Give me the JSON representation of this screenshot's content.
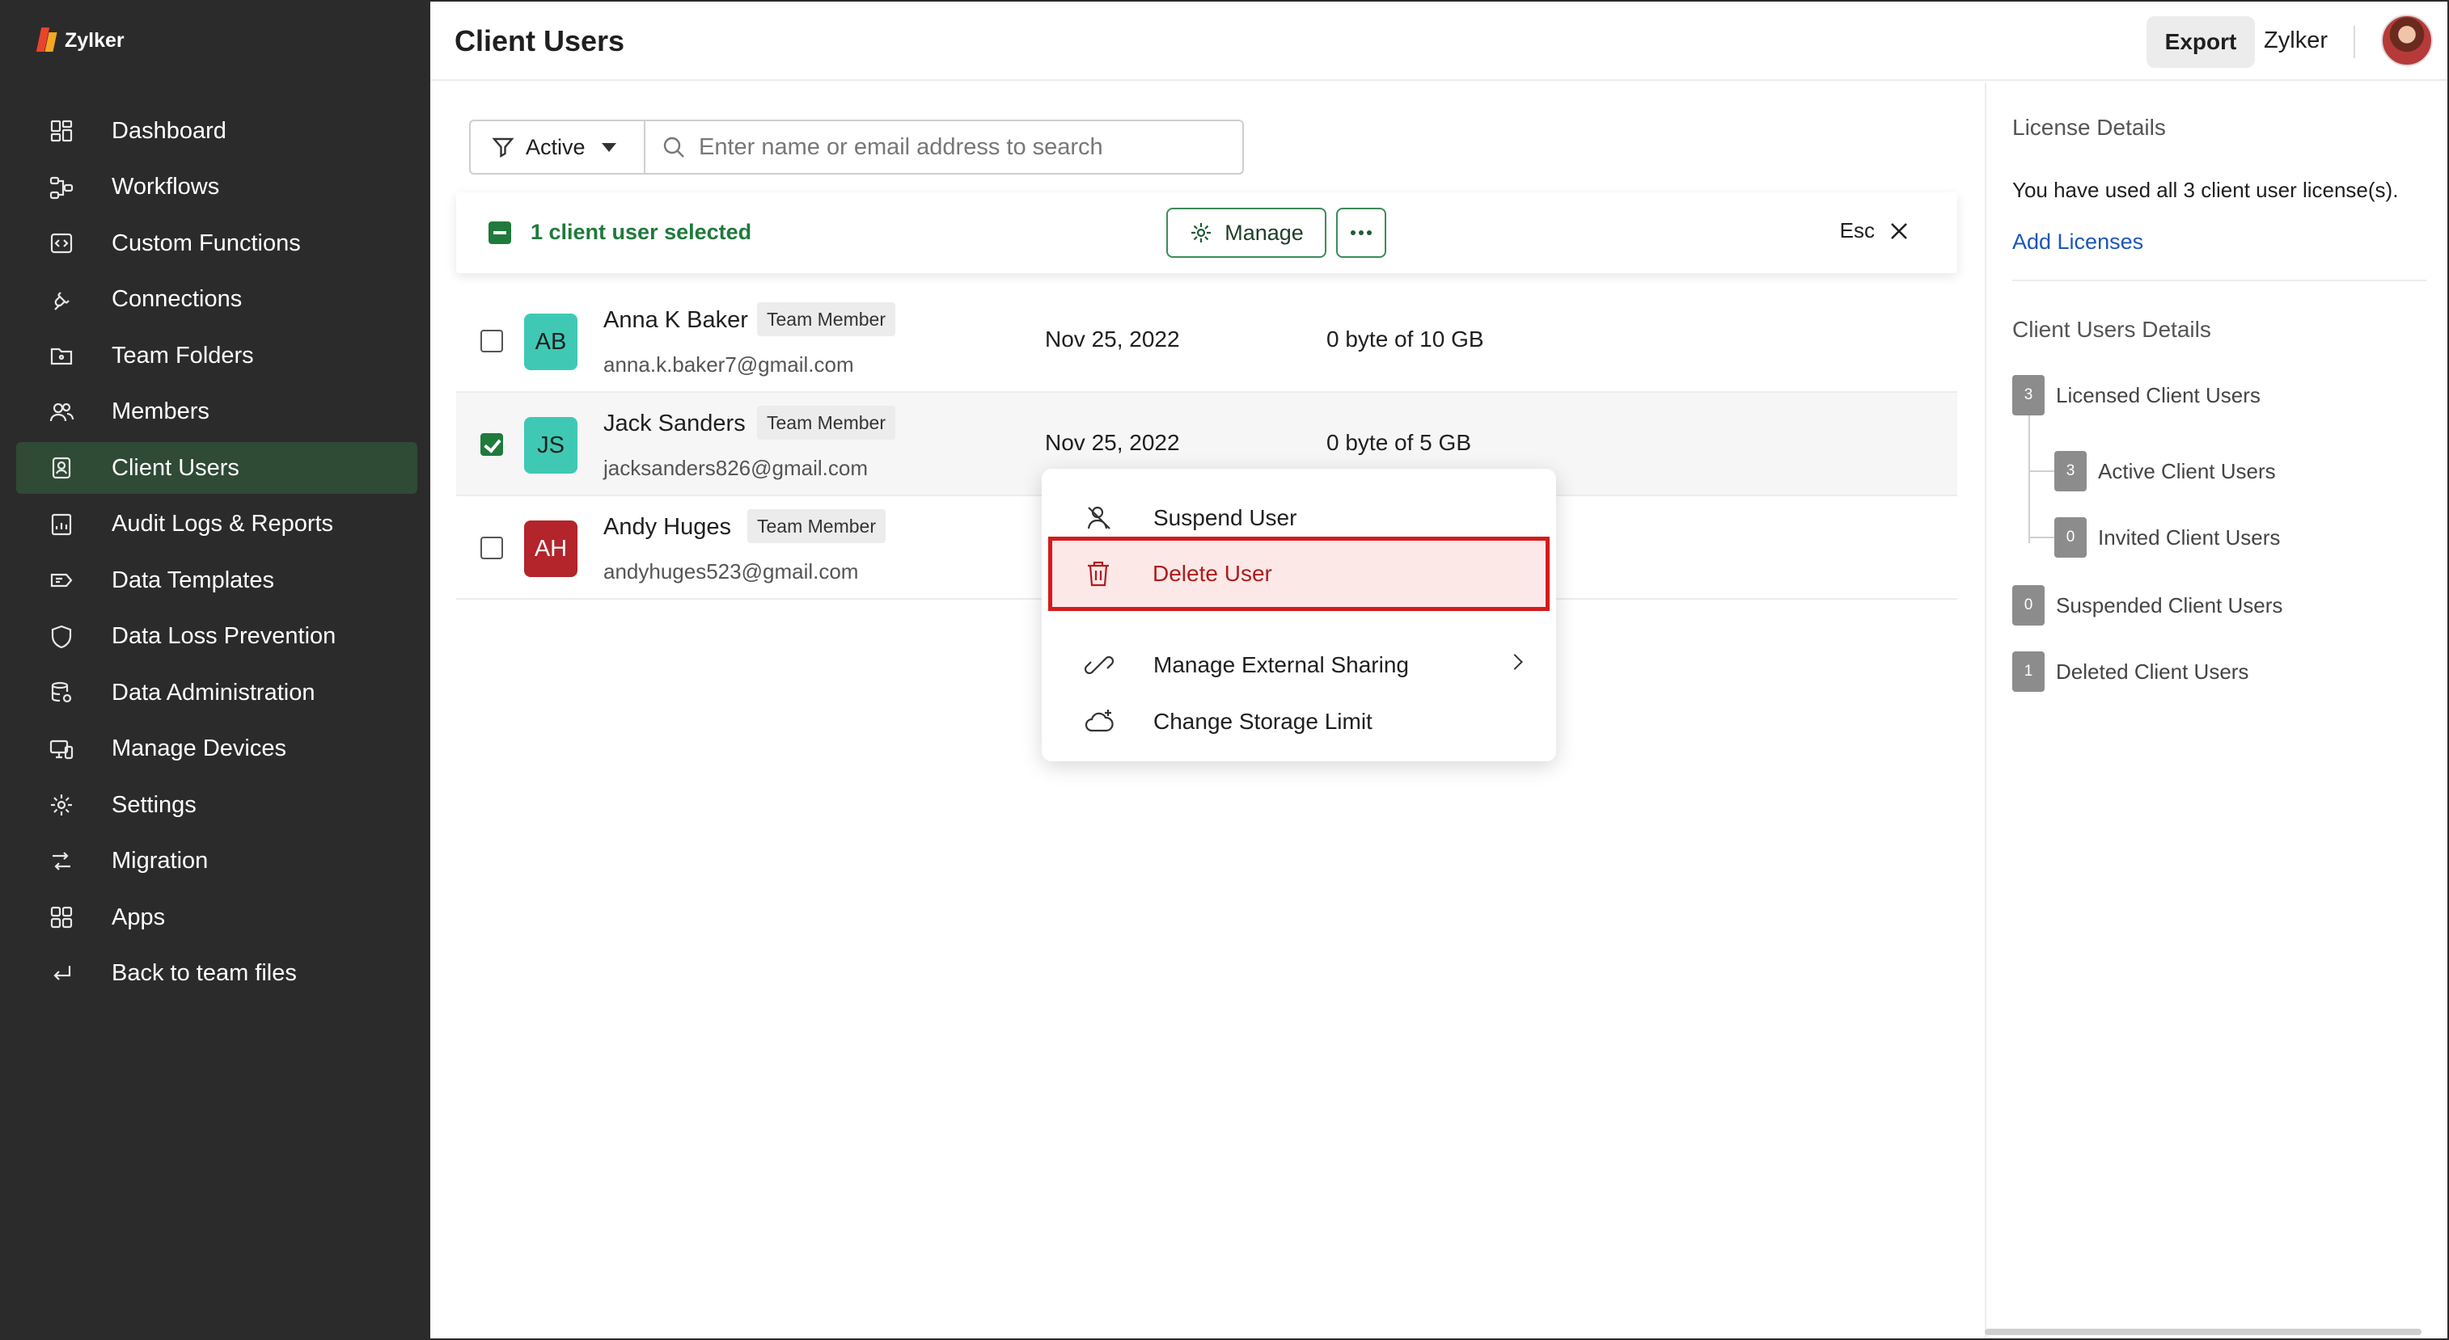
{
  "app": {
    "brand": "Zylker"
  },
  "sidebar": {
    "items": [
      {
        "label": "Dashboard",
        "icon": "dashboard-icon"
      },
      {
        "label": "Workflows",
        "icon": "workflow-icon"
      },
      {
        "label": "Custom Functions",
        "icon": "code-icon"
      },
      {
        "label": "Connections",
        "icon": "plug-icon"
      },
      {
        "label": "Team Folders",
        "icon": "folder-icon"
      },
      {
        "label": "Members",
        "icon": "users-icon"
      },
      {
        "label": "Client Users",
        "icon": "id-badge-icon",
        "active": true
      },
      {
        "label": "Audit Logs & Reports",
        "icon": "report-icon"
      },
      {
        "label": "Data Templates",
        "icon": "tag-icon"
      },
      {
        "label": "Data Loss Prevention",
        "icon": "shield-icon"
      },
      {
        "label": "Data Administration",
        "icon": "database-icon"
      },
      {
        "label": "Manage Devices",
        "icon": "devices-icon"
      },
      {
        "label": "Settings",
        "icon": "gear-icon"
      },
      {
        "label": "Migration",
        "icon": "migration-icon"
      },
      {
        "label": "Apps",
        "icon": "apps-icon"
      },
      {
        "label": "Back to team files",
        "icon": "back-arrow-icon"
      }
    ]
  },
  "header": {
    "title": "Client Users",
    "export_label": "Export",
    "org_name": "Zylker"
  },
  "filter": {
    "status": "Active",
    "search_placeholder": "Enter name or email address to search"
  },
  "selection": {
    "text": "1 client user selected",
    "manage_label": "Manage",
    "esc_label": "Esc"
  },
  "users": [
    {
      "initials": "AB",
      "avatar_color": "#3fc9b4",
      "name": "Anna K Baker",
      "role": "Team Member",
      "email": "anna.k.baker7@gmail.com",
      "date": "Nov 25, 2022",
      "storage": "0 byte of 10 GB",
      "checked": false
    },
    {
      "initials": "JS",
      "avatar_color": "#3fc9b4",
      "name": "Jack Sanders",
      "role": "Team Member",
      "email": "jacksanders826@gmail.com",
      "date": "Nov 25, 2022",
      "storage": "0 byte of 5 GB",
      "checked": true
    },
    {
      "initials": "AH",
      "avatar_color": "#b3242b",
      "name": "Andy Huges",
      "role": "Team Member",
      "email": "andyhuges523@gmail.com",
      "date": "",
      "storage": "",
      "checked": false
    }
  ],
  "context_menu": {
    "items": [
      {
        "label": "Suspend User",
        "icon": "suspend-user-icon"
      },
      {
        "label": "Delete User",
        "icon": "trash-icon",
        "highlighted": true
      },
      {
        "label": "Manage External Sharing",
        "icon": "share-link-icon",
        "submenu": true
      },
      {
        "label": "Change Storage Limit",
        "icon": "cloud-plus-icon"
      }
    ]
  },
  "right_panel": {
    "license_title": "License Details",
    "license_text": "You have used all 3 client user license(s).",
    "add_licenses_label": "Add Licenses",
    "details_title": "Client Users Details",
    "stats": [
      {
        "count": "3",
        "label": "Licensed Client Users"
      },
      {
        "count": "3",
        "label": "Active Client Users"
      },
      {
        "count": "0",
        "label": "Invited Client Users"
      },
      {
        "count": "0",
        "label": "Suspended Client Users"
      },
      {
        "count": "1",
        "label": "Deleted Client Users"
      }
    ]
  },
  "colors": {
    "sidebar_bg": "#2b2b2b",
    "active_nav": "#2f4a35",
    "accent_green": "#1f7a3c",
    "danger_red": "#d51b1b",
    "link_blue": "#1a56b8"
  }
}
